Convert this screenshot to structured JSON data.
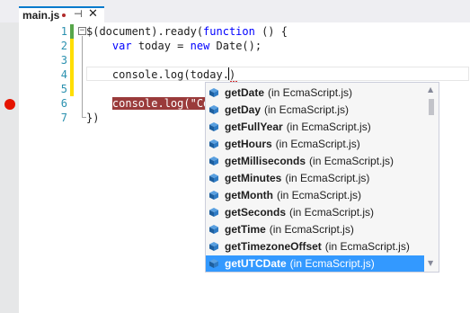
{
  "tab": {
    "title": "main.js"
  },
  "line_numbers": [
    "1",
    "2",
    "3",
    "4",
    "5",
    "6",
    "7"
  ],
  "code": {
    "l1a": "$(document).ready(",
    "l1kw": "function",
    "l1b": " () {",
    "l2a": "    ",
    "l2kw1": "var",
    "l2b": " today = ",
    "l2kw2": "new",
    "l2c": " Date();",
    "l4": "    console.log(today.)",
    "l6_pre": "    ",
    "l6_bp": "console.log(\"Co",
    "l7": "})"
  },
  "completion": {
    "items": [
      {
        "name": "getDate",
        "source": "(in EcmaScript.js)"
      },
      {
        "name": "getDay",
        "source": "(in EcmaScript.js)"
      },
      {
        "name": "getFullYear",
        "source": "(in EcmaScript.js)"
      },
      {
        "name": "getHours",
        "source": "(in EcmaScript.js)"
      },
      {
        "name": "getMilliseconds",
        "source": "(in EcmaScript.js)"
      },
      {
        "name": "getMinutes",
        "source": "(in EcmaScript.js)"
      },
      {
        "name": "getMonth",
        "source": "(in EcmaScript.js)"
      },
      {
        "name": "getSeconds",
        "source": "(in EcmaScript.js)"
      },
      {
        "name": "getTime",
        "source": "(in EcmaScript.js)"
      },
      {
        "name": "getTimezoneOffset",
        "source": "(in EcmaScript.js)"
      },
      {
        "name": "getUTCDate",
        "source": "(in EcmaScript.js)"
      }
    ],
    "selected_index": 10,
    "icon": "method-cube-icon"
  },
  "colors": {
    "accent": "#007acc",
    "selection": "#3399ff",
    "breakpoint": "#e51400",
    "breakpoint_line": "#9a3b3b",
    "saved_change": "#57a64a",
    "unsaved_change": "#ffde00"
  }
}
